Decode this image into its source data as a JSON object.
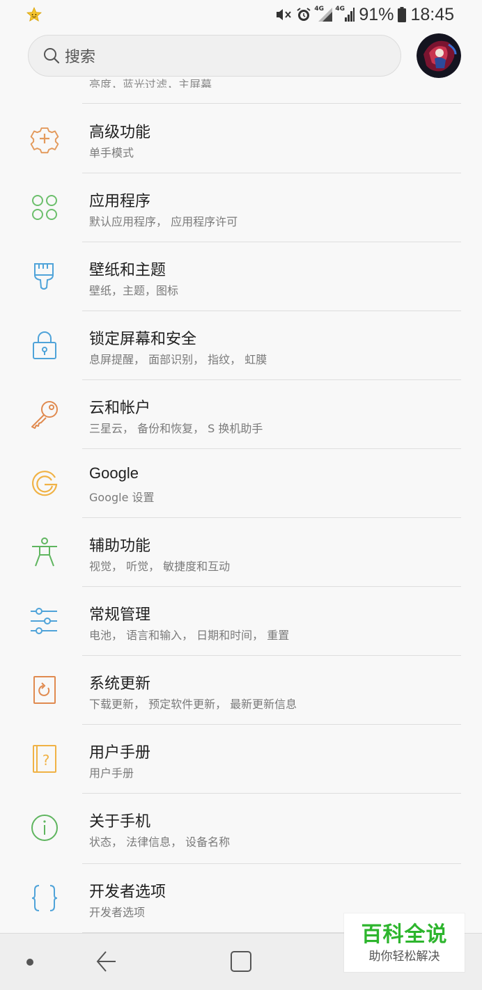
{
  "status_bar": {
    "notification_icon": "star-face-icon",
    "icons": [
      "mute-vibrate-icon",
      "alarm-icon",
      "4g-signal-icon",
      "4g-signal-icon"
    ],
    "network_label_1": "4G",
    "network_label_2": "4G",
    "battery_percent": "91%",
    "time": "18:45"
  },
  "header": {
    "search_placeholder": "搜索",
    "avatar": "profile-avatar"
  },
  "partial_item": {
    "subtitle": "亮度，蓝光过滤，主屏幕"
  },
  "settings": [
    {
      "title": "高级功能",
      "subtitle": "单手模式",
      "icon": "gear-plus-icon",
      "color": "#e39a5c"
    },
    {
      "title": "应用程序",
      "subtitle": "默认应用程序， 应用程序许可",
      "icon": "apps-grid-icon",
      "color": "#6cbf6c"
    },
    {
      "title": "壁纸和主题",
      "subtitle": "壁纸，主题，图标",
      "icon": "paintbrush-icon",
      "color": "#4fa3d9"
    },
    {
      "title": "锁定屏幕和安全",
      "subtitle": "息屏提醒， 面部识别， 指纹， 虹膜",
      "icon": "lock-icon",
      "color": "#4fa3d9"
    },
    {
      "title": "云和帐户",
      "subtitle": "三星云， 备份和恢复， S 换机助手",
      "icon": "key-icon",
      "color": "#e08a4f"
    },
    {
      "title": "Google",
      "subtitle": "Google 设置",
      "icon": "google-icon",
      "color": "#f0b245"
    },
    {
      "title": "辅助功能",
      "subtitle": "视觉， 听觉， 敏捷度和互动",
      "icon": "accessibility-icon",
      "color": "#5fb55f"
    },
    {
      "title": "常规管理",
      "subtitle": "电池， 语言和输入， 日期和时间， 重置",
      "icon": "sliders-icon",
      "color": "#4fa3d9"
    },
    {
      "title": "系统更新",
      "subtitle": "下载更新， 预定软件更新， 最新更新信息",
      "icon": "system-update-icon",
      "color": "#e08a4f"
    },
    {
      "title": "用户手册",
      "subtitle": "用户手册",
      "icon": "manual-icon",
      "color": "#f0b245"
    },
    {
      "title": "关于手机",
      "subtitle": "状态， 法律信息， 设备名称",
      "icon": "info-icon",
      "color": "#5fb55f"
    },
    {
      "title": "开发者选项",
      "subtitle": "开发者选项",
      "icon": "braces-icon",
      "color": "#4fa3d9"
    }
  ],
  "nav_bar": {
    "items": [
      "recent-dot",
      "back-icon",
      "home-icon"
    ]
  },
  "watermark": {
    "title": "百科全说",
    "subtitle": "助你轻松解决"
  }
}
